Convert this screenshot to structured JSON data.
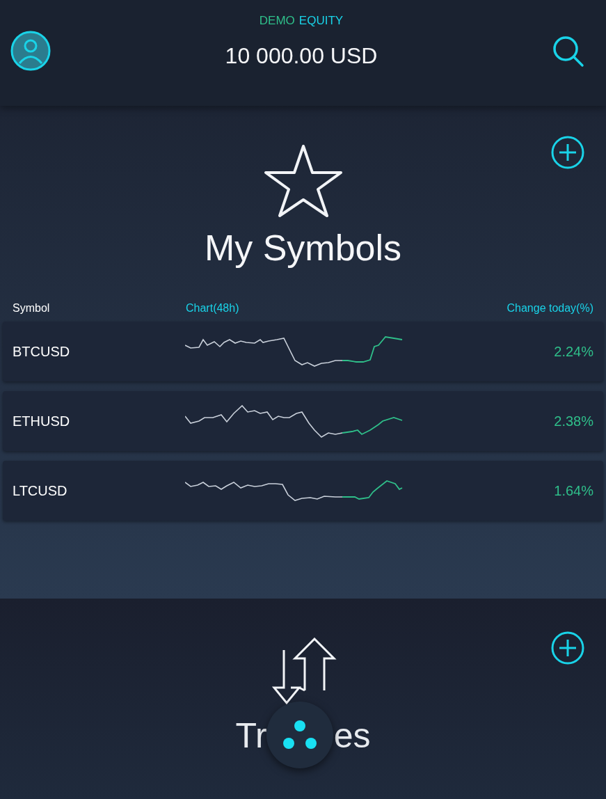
{
  "header": {
    "label_parts": [
      {
        "text": "DEMO",
        "color": "#2fbf8a"
      },
      {
        "text": "EQUITY",
        "color": "#19d3e8"
      }
    ],
    "balance": "10 000.00 USD"
  },
  "symbols_section": {
    "title": "My Symbols",
    "columns": [
      "Symbol",
      "Chart(48h)",
      "Change today(%)"
    ],
    "rows": [
      {
        "symbol": "BTCUSD",
        "change": "2.24%"
      },
      {
        "symbol": "ETHUSD",
        "change": "2.38%"
      },
      {
        "symbol": "LTCUSD",
        "change": "1.64%"
      }
    ]
  },
  "trades_section": {
    "title_parts": [
      "Tr",
      "es"
    ]
  }
}
